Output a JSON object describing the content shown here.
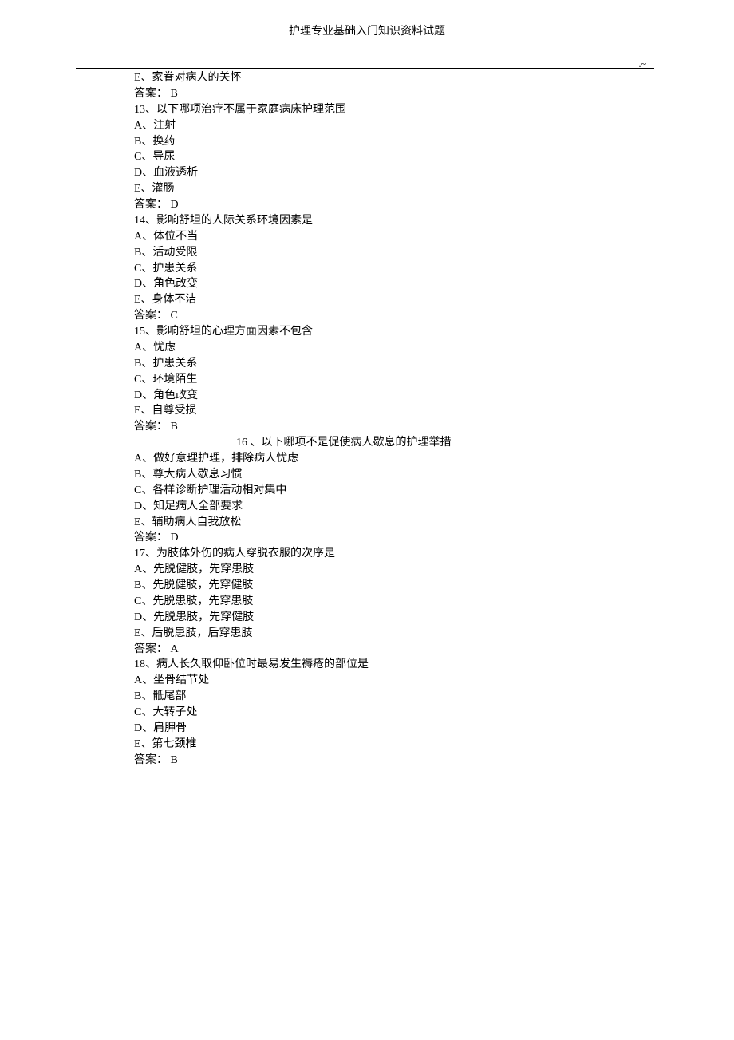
{
  "header": {
    "title": "护理专业基础入门知识资料试题",
    "marker": ".~"
  },
  "questions": [
    {
      "stem_prefix": "",
      "stem": "",
      "options": [
        "E、家眷对病人的关怀"
      ],
      "answer": "答案： B"
    },
    {
      "stem": "13、以下哪项治疗不属于家庭病床护理范围",
      "options": [
        "A、注射",
        "B、换药",
        "C、导尿",
        "D、血液透析",
        "E、灌肠"
      ],
      "answer": "答案： D"
    },
    {
      "stem": "14、影响舒坦的人际关系环境因素是",
      "options": [
        "A、体位不当",
        "B、活动受限",
        "C、护患关系",
        "D、角色改变",
        "E、身体不洁"
      ],
      "answer": "答案： C"
    },
    {
      "stem": "15、影响舒坦的心理方面因素不包含",
      "options": [
        "A、忧虑",
        "B、护患关系",
        "C、环境陌生",
        "D、角色改变",
        "E、自尊受损"
      ],
      "answer": "答案： B"
    },
    {
      "stem": "16 、以下哪项不是促使病人歇息的护理举措",
      "indented": true,
      "options": [
        "A、做好意理护理，排除病人忧虑",
        "B、尊大病人歇息习惯",
        "C、各样诊断护理活动相对集中",
        "D、知足病人全部要求",
        "E、辅助病人自我放松"
      ],
      "answer": "答案： D"
    },
    {
      "stem": "17、为肢体外伤的病人穿脱衣服的次序是",
      "options": [
        "A、先脱健肢，先穿患肢",
        "B、先脱健肢，先穿健肢",
        "C、先脱患肢，先穿患肢",
        "D、先脱患肢，先穿健肢",
        "E、后脱患肢，后穿患肢"
      ],
      "answer": "答案： A"
    },
    {
      "stem": "18、病人长久取仰卧位时最易发生褥疮的部位是",
      "options": [
        "A、坐骨结节处",
        "B、骶尾部",
        "C、大转子处",
        "D、肩胛骨",
        "E、第七颈椎"
      ],
      "answer": "答案： B"
    }
  ]
}
